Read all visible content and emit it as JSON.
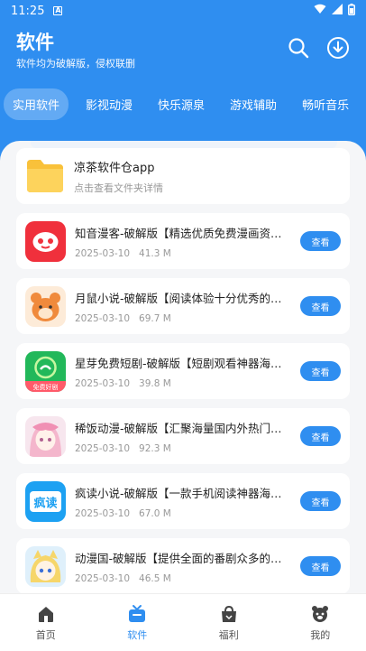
{
  "status": {
    "time": "11:25",
    "sim_label": "A"
  },
  "header": {
    "title": "软件",
    "subtitle": "软件均为破解版，侵权联删"
  },
  "tabs": [
    {
      "label": "实用软件",
      "active": true
    },
    {
      "label": "影视动漫"
    },
    {
      "label": "快乐源泉"
    },
    {
      "label": "游戏辅助"
    },
    {
      "label": "畅听音乐"
    }
  ],
  "folder": {
    "title": "凉茶软件仓app",
    "subtitle": "点击查看文件夹详情"
  },
  "apps": [
    {
      "title": "知音漫客-破解版【精选优质免费漫画资源，上千部...",
      "date": "2025-03-10",
      "size": "41.3 M",
      "button": "查看"
    },
    {
      "title": "月鼠小说-破解版【阅读体验十分优秀的小说阅读器...",
      "date": "2025-03-10",
      "size": "69.7 M",
      "button": "查看"
    },
    {
      "title": "星芽免费短剧-破解版【短剧观看神器海量短剧...",
      "date": "2025-03-10",
      "size": "39.8 M",
      "button": "查看",
      "icon_text": "免费好剧"
    },
    {
      "title": "稀饭动漫-破解版【汇聚海量国内外热门动漫资源...",
      "date": "2025-03-10",
      "size": "92.3 M",
      "button": "查看"
    },
    {
      "title": "疯读小说-破解版【一款手机阅读神器海量小说...",
      "date": "2025-03-10",
      "size": "67.0 M",
      "button": "查看",
      "icon_text": "疯读"
    },
    {
      "title": "动漫国-破解版【提供全面的番剧众多的动漫资源...",
      "date": "2025-03-10",
      "size": "46.5 M",
      "button": "查看"
    }
  ],
  "nav": [
    {
      "label": "首页",
      "icon": "home-icon"
    },
    {
      "label": "软件",
      "icon": "software-icon",
      "active": true
    },
    {
      "label": "福利",
      "icon": "gift-bag-icon"
    },
    {
      "label": "我的",
      "icon": "profile-icon"
    }
  ],
  "colors": {
    "accent": "#2f8ef0",
    "sheet_bg": "#f5f6f8"
  }
}
